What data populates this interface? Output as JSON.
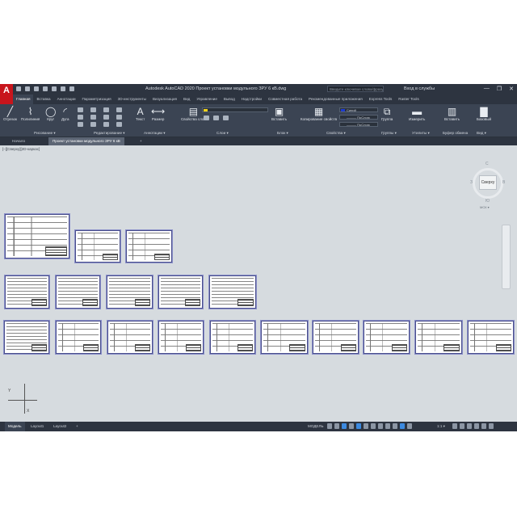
{
  "app": {
    "logo": "A",
    "title": "Autodesk AutoCAD 2020    Проект установки модульного ЗРУ 6 кВ.dwg",
    "search_placeholder": "Введите ключевое слово/фразу",
    "signin": "Вход в службы",
    "window_controls": [
      "—",
      "❐",
      "✕"
    ]
  },
  "ribbon_tabs": [
    "Главная",
    "Вставка",
    "Аннотации",
    "Параметризация",
    "3D-инструменты",
    "Визуализация",
    "Вид",
    "Управление",
    "Вывод",
    "Надстройки",
    "Совместная работа",
    "Рекомендованные приложения",
    "Express Tools",
    "Raster Tools"
  ],
  "ribbon": {
    "draw_buttons": [
      "Отрезок",
      "Полилиния",
      "Круг",
      "Дуга"
    ],
    "text_btn": "Текст",
    "dim_btn": "Размер",
    "layer_props_btn": "Свойства слоя",
    "insert_btn": "Вставить",
    "match_btn": "Копирование свойств",
    "group_btn": "Группа",
    "measure_btn": "Измерить",
    "paste_btn": "Вставить",
    "base_btn": "Базовый",
    "color_field": "Синий",
    "linetype_field": "——— ПоСлою",
    "lineweight_field": "——— ПоСлою",
    "panels": [
      "Рисование ▾",
      "Редактирование ▾",
      "Аннотации ▾",
      "Слои ▾",
      "Блок ▾",
      "Свойства ▾",
      "Группы ▾",
      "Утилиты ▾",
      "Буфер обмена",
      "Вид ▾"
    ]
  },
  "doc_tabs": [
    "Начало",
    "Проект установки модульного ЗРУ 6 кВ",
    "+"
  ],
  "canvas": {
    "viewport_label": "[–][Сверху][2D-каркас]",
    "viewcube": {
      "face": "Сверху",
      "north": "С",
      "south": "Ю",
      "west": "З",
      "east": "В",
      "wcs": "МСК ▾"
    },
    "ucs": {
      "x": "X",
      "y": "Y"
    }
  },
  "status": {
    "layouts": [
      "Модель",
      "Layout1",
      "Layout2",
      "+"
    ],
    "mode": "МОДЕЛЬ",
    "scale": "1:1 ▾"
  },
  "colors": {
    "app_bg": "#3b4453",
    "canvas": "#d6dbdf",
    "brand": "#c8151c",
    "sheet_border": "#4a4f8c"
  }
}
